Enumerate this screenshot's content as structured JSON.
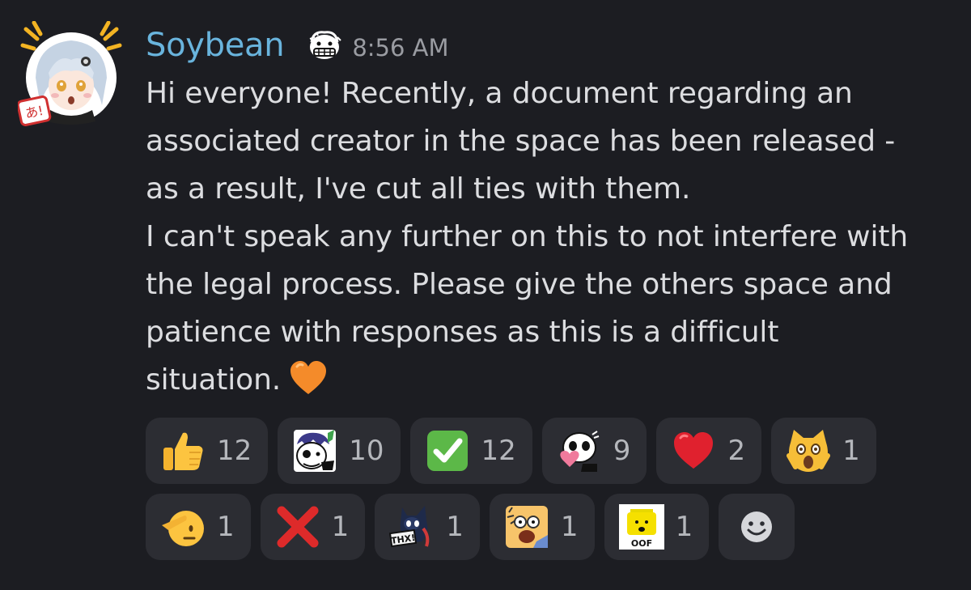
{
  "message": {
    "username": "Soybean",
    "timestamp": "8:56 AM",
    "lines": [
      "Hi everyone! Recently, a document regarding an",
      "associated creator in the space has been released -",
      "as a result, I've cut all ties with them.",
      "I can't speak any further on this to not interfere with",
      "the legal process. Please give the others space and",
      "patience with responses as this is a difficult",
      "situation."
    ],
    "avatar_icon": "anime-girl-avatar",
    "role_icon": "grinning-face-badge-icon",
    "trailing_emoji": "orange-heart-emoji"
  },
  "reactions_row1": [
    {
      "emoji": "thumbs-up",
      "count": "12"
    },
    {
      "emoji": "custom-character-sticker",
      "count": "10"
    },
    {
      "emoji": "check-mark",
      "count": "12"
    },
    {
      "emoji": "heart-panda",
      "count": "9"
    },
    {
      "emoji": "red-heart",
      "count": "2"
    },
    {
      "emoji": "screaming-cat",
      "count": "1"
    }
  ],
  "reactions_row2": [
    {
      "emoji": "saluting-face",
      "count": "1"
    },
    {
      "emoji": "cross-mark",
      "count": "1"
    },
    {
      "emoji": "thx-character",
      "count": "1"
    },
    {
      "emoji": "shocked-character",
      "count": "1"
    },
    {
      "emoji": "oof-head",
      "count": "1"
    }
  ],
  "add_reaction_icon": "add-reaction-smiley-icon",
  "colors": {
    "background": "#1c1d22",
    "username": "#69b4dd",
    "text": "#dcdde0",
    "reaction_bg": "#2c2d33"
  }
}
